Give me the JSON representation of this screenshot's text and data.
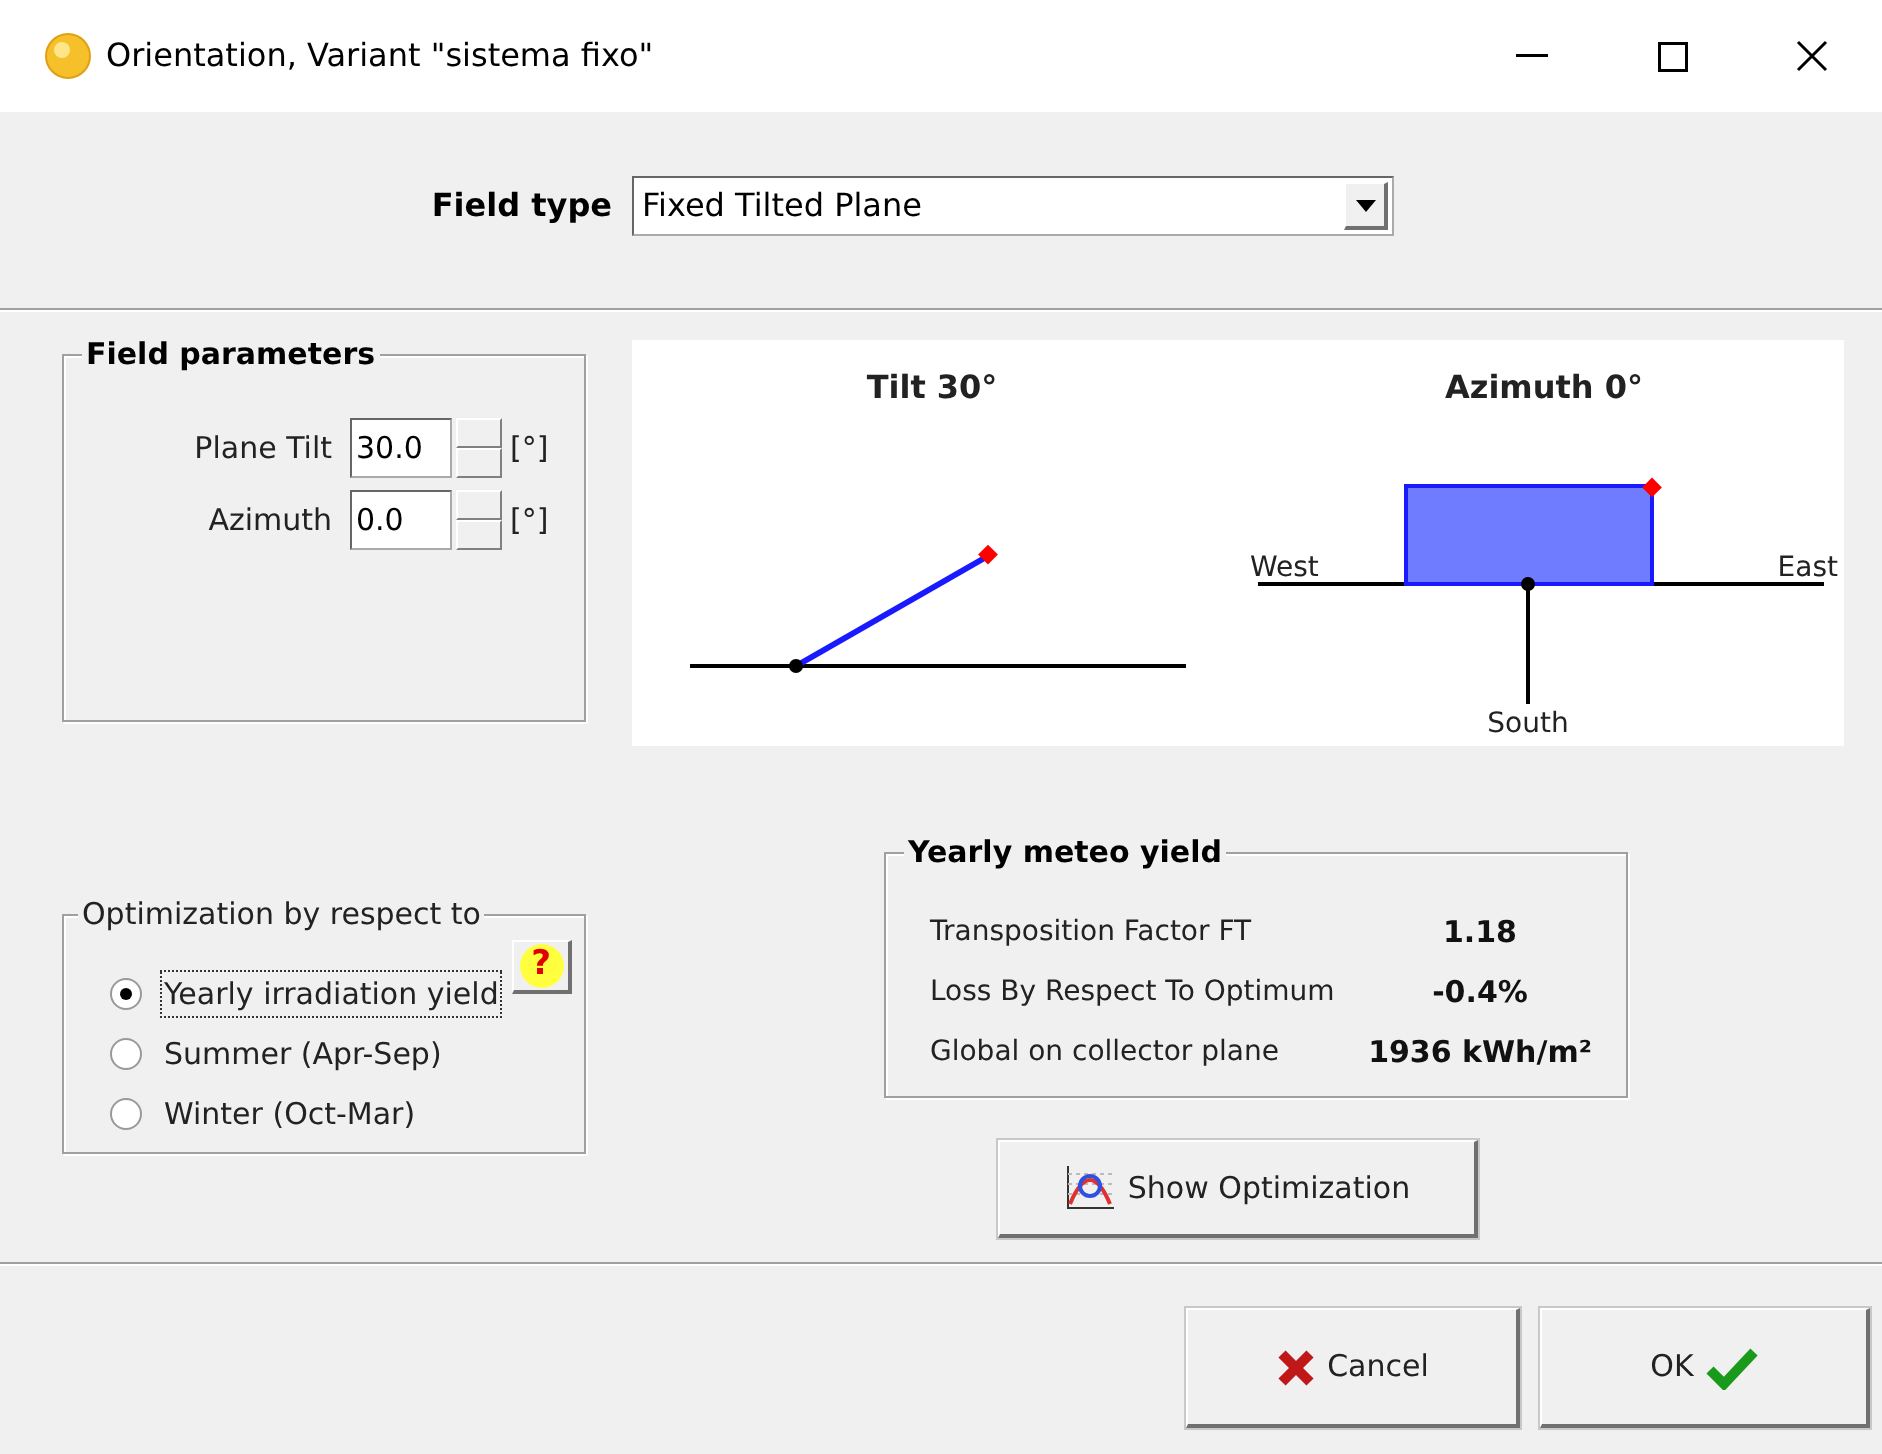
{
  "window": {
    "title": "Orientation, Variant \"sistema fixo\""
  },
  "field_type": {
    "label": "Field type",
    "value": "Fixed Tilted Plane"
  },
  "field_parameters": {
    "title": "Field parameters",
    "fields": [
      {
        "label": "Plane Tilt",
        "value": "30.0",
        "unit": "[°]"
      },
      {
        "label": "Azimuth",
        "value": "0.0",
        "unit": "[°]"
      }
    ]
  },
  "diagram": {
    "tilt_title": "Tilt 30°",
    "azimuth_title": "Azimuth 0°",
    "west": "West",
    "east": "East",
    "south": "South"
  },
  "optimization": {
    "title": "Optimization by respect to",
    "help": "?",
    "options": [
      {
        "label": "Yearly irradiation yield",
        "selected": true
      },
      {
        "label": "Summer (Apr-Sep)",
        "selected": false
      },
      {
        "label": "Winter (Oct-Mar)",
        "selected": false
      }
    ]
  },
  "yearly_meteo_yield": {
    "title": "Yearly meteo yield",
    "rows": [
      {
        "label": "Transposition Factor FT",
        "value": "1.18"
      },
      {
        "label": "Loss By Respect To Optimum",
        "value": "-0.4%"
      },
      {
        "label": "Global on collector plane",
        "value": "1936 kWh/m²"
      }
    ]
  },
  "show_optimization": {
    "label": "Show Optimization"
  },
  "buttons": [
    {
      "kind": "cancel",
      "label": "Cancel"
    },
    {
      "kind": "ok",
      "label": "OK"
    }
  ]
}
